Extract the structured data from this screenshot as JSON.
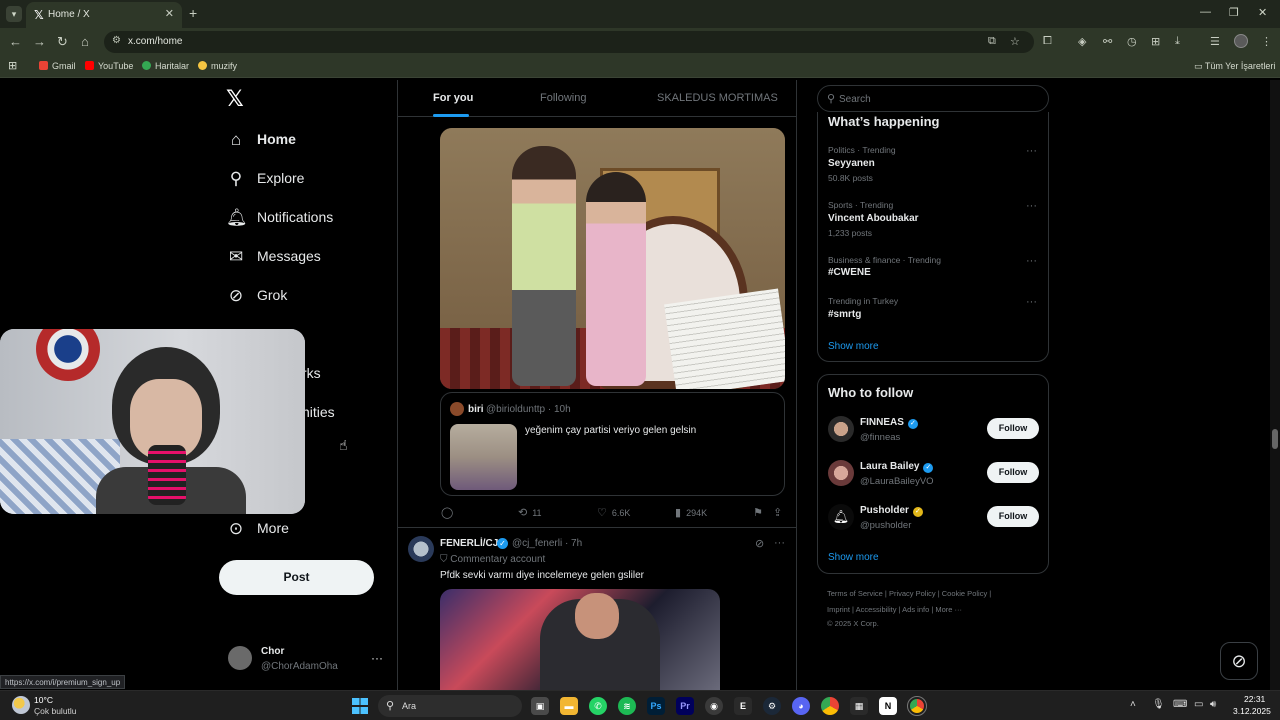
{
  "browser": {
    "tab_title": "Home / X",
    "url": "x.com/home",
    "bookmarks": [
      "Gmail",
      "YouTube",
      "Haritalar",
      "muzify"
    ],
    "all_bookmarks": "Tüm Yer İşaretleri",
    "status_url": "https://x.com/i/premium_sign_up"
  },
  "nav": {
    "items": [
      {
        "label": "Home",
        "icon": "home-icon"
      },
      {
        "label": "Explore",
        "icon": "search-icon"
      },
      {
        "label": "Notifications",
        "icon": "bell-icon"
      },
      {
        "label": "Messages",
        "icon": "envelope-icon"
      },
      {
        "label": "Grok",
        "icon": "grok-icon"
      }
    ],
    "partial": [
      "rks",
      "nities"
    ],
    "more_label": "More",
    "post_label": "Post"
  },
  "account": {
    "name": "Chor",
    "handle": "@ChorAdamOha"
  },
  "timeline": {
    "tabs": [
      "For you",
      "Following",
      "SKALEDUS MORTIMAS"
    ],
    "quote": {
      "name": "biri",
      "handle": "@birioldunttp · 10h",
      "text": "yeğenim çay partisi veriyo gelen gelsin"
    },
    "actions": {
      "retweets": "11",
      "likes": "6.6K",
      "views": "294K"
    },
    "tweet2": {
      "name": "FENERLİ/CJ",
      "handle": "@cj_fenerli · 7h",
      "label": "Commentary account",
      "text": "Pfdk sevki varmı diye incelemeye gelen gsliler"
    }
  },
  "sidebar": {
    "search_placeholder": "Search",
    "whats_happening": "What’s happening",
    "trends": [
      {
        "category": "Politics · Trending",
        "name": "Seyyanen",
        "count": "50.8K posts"
      },
      {
        "category": "Sports · Trending",
        "name": "Vincent Aboubakar",
        "count": "1,233 posts"
      },
      {
        "category": "Business & finance · Trending",
        "name": "#CWENE",
        "count": ""
      },
      {
        "category": "Trending in Turkey",
        "name": "#smrtg",
        "count": ""
      }
    ],
    "show_more": "Show more",
    "who_to_follow": "Who to follow",
    "follow_label": "Follow",
    "suggestions": [
      {
        "name": "FINNEAS",
        "handle": "@finneas",
        "badge": "#1d9bf0"
      },
      {
        "name": "Laura Bailey",
        "handle": "@LauraBaileyVO",
        "badge": "#1d9bf0"
      },
      {
        "name": "Pusholder",
        "handle": "@pusholder",
        "badge": "#e2b719"
      }
    ],
    "footer": {
      "line1": "Terms of Service  |  Privacy Policy  |  Cookie Policy  |",
      "line2": "Imprint  |  Accessibility  |  Ads info  |  More ···",
      "line3": "© 2025 X Corp."
    }
  },
  "taskbar": {
    "temp": "10°C",
    "weather": "Çok bulutlu",
    "search": "Ara",
    "time": "22:31",
    "date": "3.12.2025"
  }
}
